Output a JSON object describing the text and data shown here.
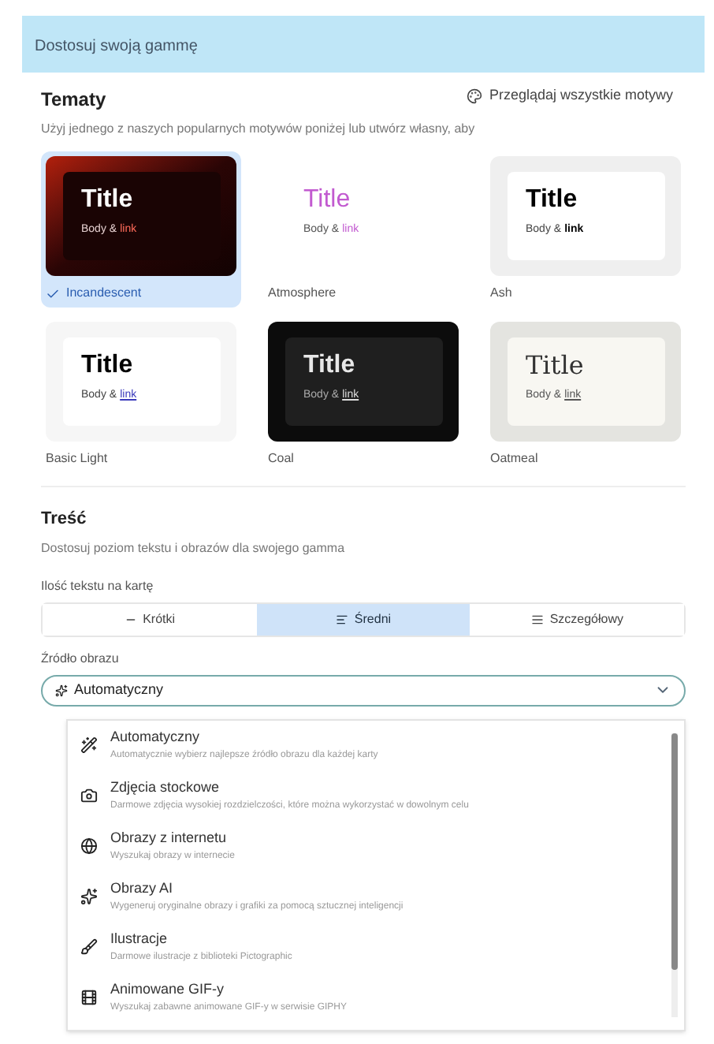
{
  "header": {
    "title": "Dostosuj swoją gammę"
  },
  "themes": {
    "title": "Tematy",
    "subtitle": "Użyj jednego z naszych popularnych motywów poniżej lub utwórz własny, aby",
    "browse_link": "Przeglądaj wszystkie motywy",
    "items": [
      {
        "name": "Incandescent",
        "title": "Title",
        "body": "Body &",
        "link": "link",
        "selected": true
      },
      {
        "name": "Atmosphere",
        "title": "Title",
        "body": "Body &",
        "link": "link",
        "selected": false
      },
      {
        "name": "Ash",
        "title": "Title",
        "body": "Body &",
        "link": "link",
        "selected": false
      },
      {
        "name": "Basic Light",
        "title": "Title",
        "body": "Body &",
        "link": "link",
        "selected": false
      },
      {
        "name": "Coal",
        "title": "Title",
        "body": "Body &",
        "link": "link",
        "selected": false
      },
      {
        "name": "Oatmeal",
        "title": "Title",
        "body": "Body &",
        "link": "link",
        "selected": false
      }
    ]
  },
  "content": {
    "title": "Treść",
    "subtitle": "Dostosuj poziom tekstu i obrazów dla swojego gamma",
    "amount_label": "Ilość tekstu na kartę",
    "amounts": [
      {
        "label": "Krótki",
        "selected": false
      },
      {
        "label": "Średni",
        "selected": true
      },
      {
        "label": "Szczegółowy",
        "selected": false
      }
    ],
    "source_label": "Źródło obrazu",
    "source_value": "Automatyczny",
    "options": [
      {
        "label": "Automatyczny",
        "description": "Automatycznie wybierz najlepsze źródło obrazu dla każdej karty"
      },
      {
        "label": "Zdjęcia stockowe",
        "description": "Darmowe zdjęcia wysokiej rozdzielczości, które można wykorzystać w dowolnym celu"
      },
      {
        "label": "Obrazy z internetu",
        "description": "Wyszukaj obrazy w internecie"
      },
      {
        "label": "Obrazy AI",
        "description": "Wygeneruj oryginalne obrazy i grafiki za pomocą sztucznej inteligencji"
      },
      {
        "label": "Ilustracje",
        "description": "Darmowe ilustracje z biblioteki Pictographic"
      },
      {
        "label": "Animowane GIF-y",
        "description": "Wyszukaj zabawne animowane GIF-y w serwisie GIPHY"
      }
    ]
  }
}
